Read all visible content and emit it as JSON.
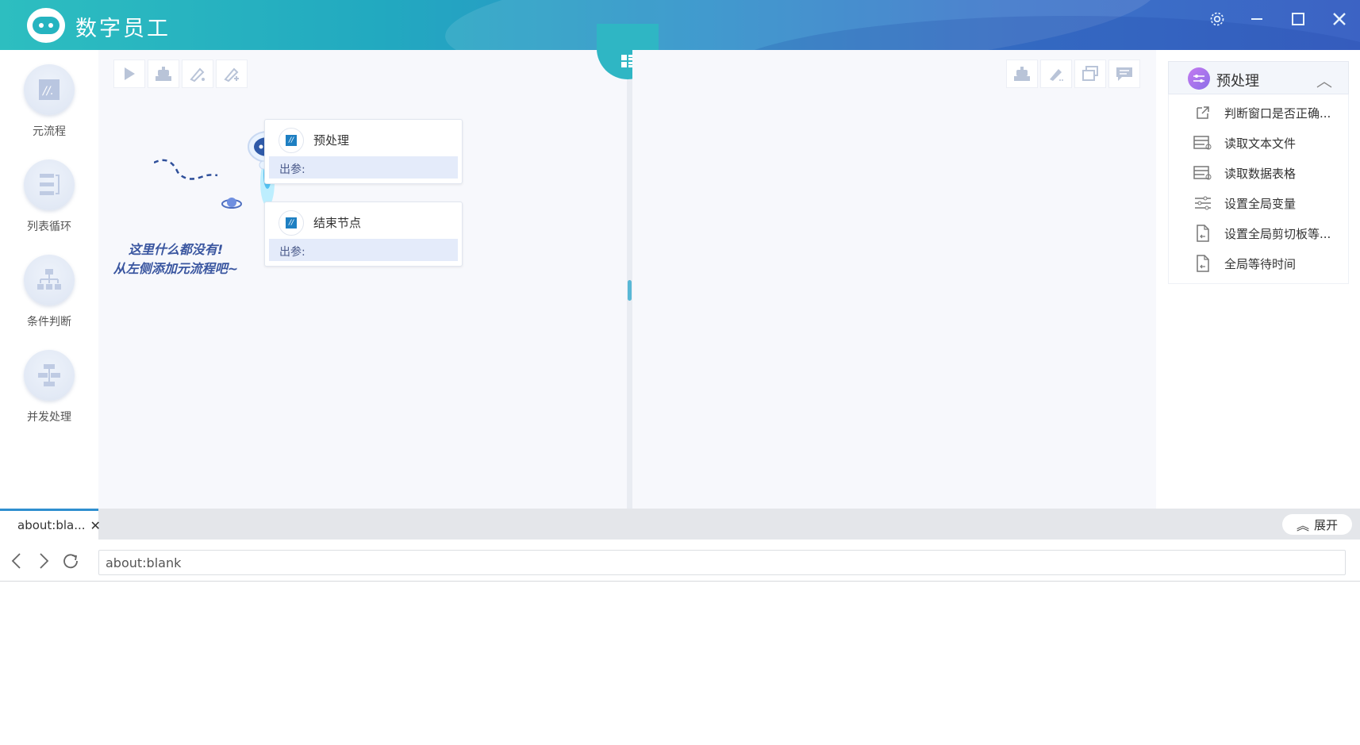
{
  "app": {
    "title": "数字员工"
  },
  "window": {
    "settings": "⚙",
    "minimize": "—",
    "maximize": "☐",
    "close": "✕"
  },
  "palette": {
    "items": [
      {
        "label": "元流程",
        "icon": "meta-flow-icon"
      },
      {
        "label": "列表循环",
        "icon": "list-loop-icon"
      },
      {
        "label": "条件判断",
        "icon": "condition-icon"
      },
      {
        "label": "并发处理",
        "icon": "concurrent-icon"
      }
    ]
  },
  "canvas": {
    "empty_hint_line1": "这里什么都没有!",
    "empty_hint_line2": "从左侧添加元流程吧~",
    "hint_close": "×",
    "nodes": [
      {
        "title": "预处理",
        "out_label": "出参:",
        "icon_text": "//"
      },
      {
        "title": "结束节点",
        "out_label": "出参:",
        "icon_text": "//"
      }
    ]
  },
  "properties": {
    "header_title": "预处理",
    "header_chevron": "︿",
    "items": [
      {
        "label": "判断窗口是否正确...",
        "icon": "external-window-icon"
      },
      {
        "label": "读取文本文件",
        "icon": "read-file-icon"
      },
      {
        "label": "读取数据表格",
        "icon": "read-table-icon"
      },
      {
        "label": "设置全局变量",
        "icon": "sliders-icon"
      },
      {
        "label": "设置全局剪切板等...",
        "icon": "clipboard-file-icon"
      },
      {
        "label": "全局等待时间",
        "icon": "wait-file-icon"
      }
    ]
  },
  "browser": {
    "tab_label": "about:bla...",
    "tab_close": "✕",
    "expand_label": "展开",
    "expand_icon": "︽",
    "nav_back": "‹",
    "nav_forward": "›",
    "nav_refresh": "↻",
    "url": "about:blank"
  }
}
